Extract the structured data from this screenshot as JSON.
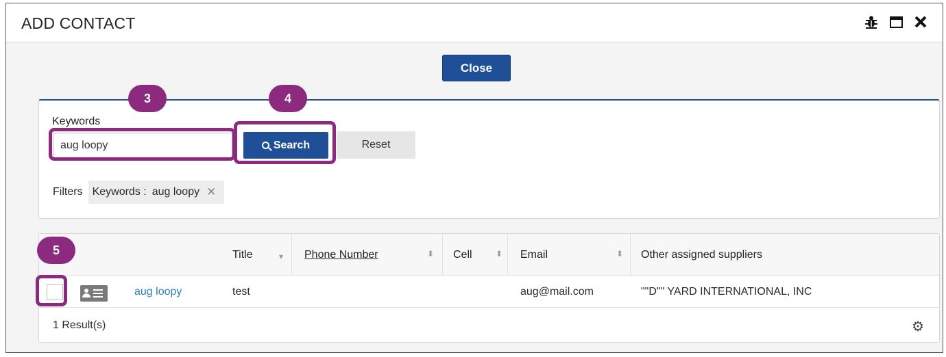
{
  "dialog": {
    "title": "ADD CONTACT",
    "icons": [
      "bug-icon",
      "maximize-icon",
      "close-icon"
    ]
  },
  "close_button": "Close",
  "search": {
    "keywords_label": "Keywords",
    "keywords_value": "aug loopy",
    "search_button": "Search",
    "reset_button": "Reset"
  },
  "filters": {
    "label": "Filters",
    "chip_name": "Keywords :",
    "chip_value": "aug loopy"
  },
  "table": {
    "columns": [
      "Title",
      "Phone Number",
      "Cell",
      "Email",
      "Other assigned suppliers"
    ],
    "rows": [
      {
        "name": "aug loopy",
        "title": "test",
        "phone": "",
        "cell": "",
        "email": "aug@mail.com",
        "suppliers": "\"\"D\"\" YARD INTERNATIONAL, INC"
      }
    ],
    "result_count": "1 Result(s)"
  },
  "annotations": {
    "step_3": "3",
    "step_4": "4",
    "step_5": "5",
    "color": "#8b2a7f"
  },
  "colors": {
    "primary": "#1f4f96",
    "link": "#2a7fc1"
  }
}
